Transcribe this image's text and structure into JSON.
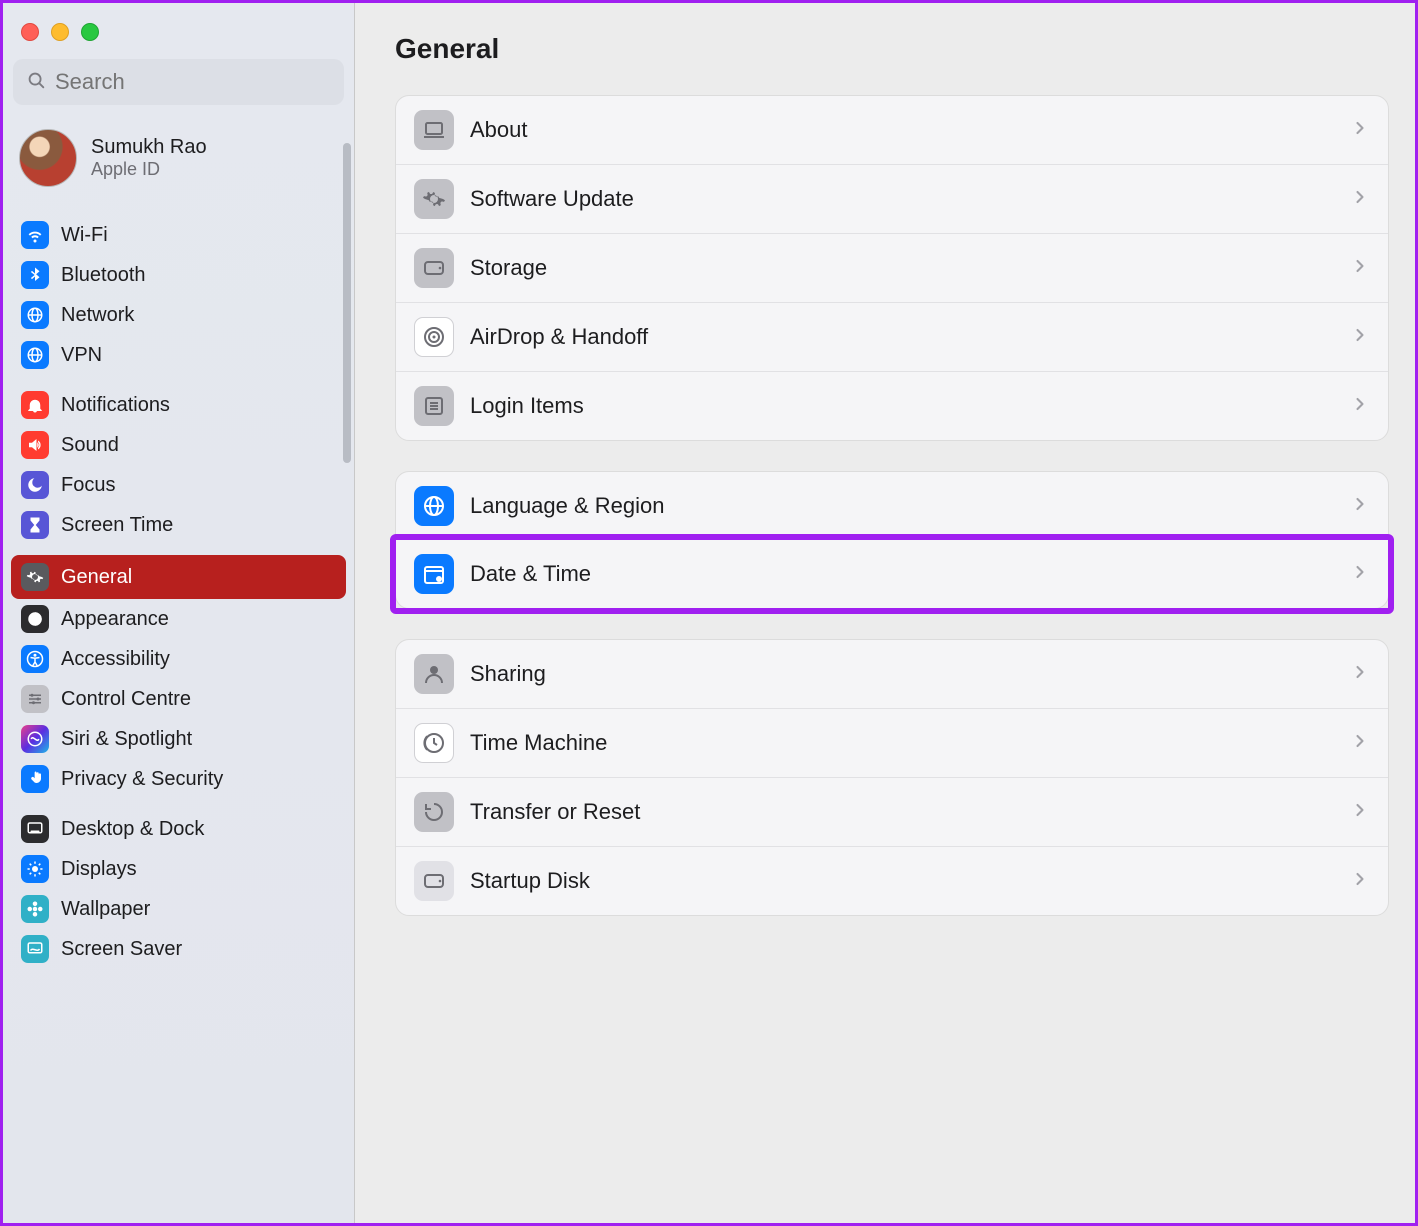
{
  "window": {
    "traffic_lights": [
      "close",
      "minimize",
      "zoom"
    ]
  },
  "search": {
    "placeholder": "Search"
  },
  "account": {
    "name": "Sumukh Rao",
    "sub": "Apple ID"
  },
  "sidebar": {
    "groups": [
      {
        "items": [
          {
            "id": "wifi",
            "label": "Wi-Fi",
            "icon": "wifi",
            "bg": "bg-blue"
          },
          {
            "id": "bluetooth",
            "label": "Bluetooth",
            "icon": "bluetooth",
            "bg": "bg-blue"
          },
          {
            "id": "network",
            "label": "Network",
            "icon": "globe",
            "bg": "bg-blue"
          },
          {
            "id": "vpn",
            "label": "VPN",
            "icon": "globe",
            "bg": "bg-blue"
          }
        ]
      },
      {
        "items": [
          {
            "id": "notifications",
            "label": "Notifications",
            "icon": "bell",
            "bg": "bg-red"
          },
          {
            "id": "sound",
            "label": "Sound",
            "icon": "speaker",
            "bg": "bg-red"
          },
          {
            "id": "focus",
            "label": "Focus",
            "icon": "moon",
            "bg": "bg-purple"
          },
          {
            "id": "screentime",
            "label": "Screen Time",
            "icon": "hourglass",
            "bg": "bg-purple"
          }
        ]
      },
      {
        "items": [
          {
            "id": "general",
            "label": "General",
            "icon": "gear",
            "bg": "bg-darkg",
            "selected": true
          },
          {
            "id": "appearance",
            "label": "Appearance",
            "icon": "contrast",
            "bg": "bg-black"
          },
          {
            "id": "accessibility",
            "label": "Accessibility",
            "icon": "accessibility",
            "bg": "bg-blue"
          },
          {
            "id": "controlcentre",
            "label": "Control Centre",
            "icon": "sliders",
            "bg": "bg-grey"
          },
          {
            "id": "siri",
            "label": "Siri & Spotlight",
            "icon": "siri",
            "bg": "bg-siri"
          },
          {
            "id": "privacy",
            "label": "Privacy & Security",
            "icon": "hand",
            "bg": "bg-blue"
          }
        ]
      },
      {
        "items": [
          {
            "id": "desktop",
            "label": "Desktop & Dock",
            "icon": "dock",
            "bg": "bg-black"
          },
          {
            "id": "displays",
            "label": "Displays",
            "icon": "sun",
            "bg": "bg-blue"
          },
          {
            "id": "wallpaper",
            "label": "Wallpaper",
            "icon": "flower",
            "bg": "bg-teal"
          },
          {
            "id": "screensaver",
            "label": "Screen Saver",
            "icon": "screensaver",
            "bg": "bg-teal"
          }
        ]
      }
    ]
  },
  "main": {
    "title": "General",
    "sections": [
      {
        "rows": [
          {
            "id": "about",
            "label": "About",
            "icon": "laptop",
            "bg": "bg-grey"
          },
          {
            "id": "software-update",
            "label": "Software Update",
            "icon": "gear",
            "bg": "bg-grey"
          },
          {
            "id": "storage",
            "label": "Storage",
            "icon": "disk",
            "bg": "bg-grey"
          },
          {
            "id": "airdrop",
            "label": "AirDrop & Handoff",
            "icon": "airdrop",
            "bg": "bg-white"
          },
          {
            "id": "login-items",
            "label": "Login Items",
            "icon": "list",
            "bg": "bg-grey"
          }
        ]
      },
      {
        "rows": [
          {
            "id": "language",
            "label": "Language & Region",
            "icon": "globe",
            "bg": "bg-blue"
          },
          {
            "id": "date-time",
            "label": "Date & Time",
            "icon": "calendar",
            "bg": "bg-blue",
            "highlighted": true
          }
        ]
      },
      {
        "rows": [
          {
            "id": "sharing",
            "label": "Sharing",
            "icon": "person",
            "bg": "bg-grey"
          },
          {
            "id": "time-machine",
            "label": "Time Machine",
            "icon": "clock",
            "bg": "bg-white"
          },
          {
            "id": "transfer",
            "label": "Transfer or Reset",
            "icon": "reset",
            "bg": "bg-grey"
          },
          {
            "id": "startup",
            "label": "Startup Disk",
            "icon": "disk",
            "bg": "bg-grey2"
          }
        ]
      }
    ]
  },
  "colors": {
    "highlight": "#a020f0",
    "selection": "#b7201e",
    "accent_blue": "#0a7aff"
  }
}
